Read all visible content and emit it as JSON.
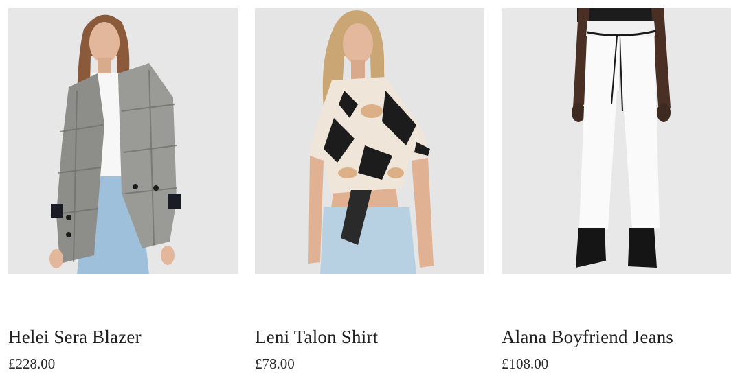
{
  "products": [
    {
      "name": "Helei Sera Blazer",
      "price": "£228.00",
      "image_alt": "model-in-check-blazer"
    },
    {
      "name": "Leni Talon Shirt",
      "price": "£78.00",
      "image_alt": "model-in-printed-tie-shirt"
    },
    {
      "name": "Alana Boyfriend Jeans",
      "price": "£108.00",
      "image_alt": "model-in-white-jeans"
    }
  ],
  "colors": {
    "image_background": "#e6e6e6",
    "text": "#1f1f1f"
  }
}
